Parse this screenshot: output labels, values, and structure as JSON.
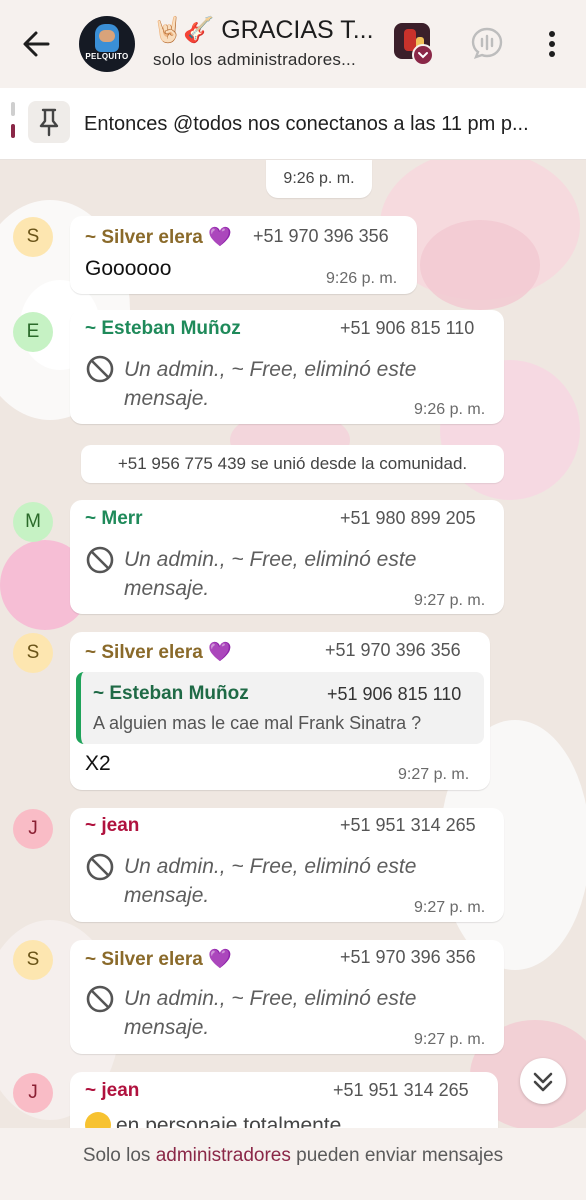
{
  "header": {
    "title": "🤘🏻🎸 GRACIAS T...",
    "subtitle": "solo los administradores...",
    "avatar_brand": "PELQUITO"
  },
  "pinned": {
    "text": "Entonces @todos  nos conectanos a las 11 pm p..."
  },
  "colors": {
    "header_bg": "#f6f1ee",
    "admin_accent": "#8a2747",
    "silver": "#8a6a2a",
    "esteban": "#1f8a5a",
    "merr": "#1f8a5a",
    "jean": "#b0123e"
  },
  "chat": {
    "top_time": "9:26 p. m.",
    "system_message": "+51 956 775 439 se unió desde la comunidad.",
    "messages": [
      {
        "initial": "S",
        "sender": "~ Silver elera 💜",
        "phone": "+51 970 396 356",
        "text": "Goooooo",
        "time": "9:26 p. m."
      },
      {
        "initial": "E",
        "sender": "~ Esteban Muñoz",
        "phone": "+51 906 815 110",
        "line1": "Un admin., ~ Free, eliminó este",
        "line2": "mensaje.",
        "time": "9:26 p. m."
      },
      {
        "initial": "M",
        "sender": "~ Merr",
        "phone": "+51 980 899 205",
        "line1": "Un admin., ~ Free, eliminó este",
        "line2": "mensaje.",
        "time": "9:27 p. m."
      },
      {
        "initial": "S",
        "sender": "~ Silver elera 💜",
        "phone": "+51 970 396 356",
        "quote_sender": "~ Esteban Muñoz",
        "quote_phone": "+51 906 815 110",
        "quote_text": "A alguien mas le cae mal Frank Sinatra ?",
        "text": "X2",
        "time": "9:27 p. m."
      },
      {
        "initial": "J",
        "sender": "~ jean",
        "phone": "+51 951 314 265",
        "line1": "Un admin., ~ Free, eliminó este",
        "line2": "mensaje.",
        "time": "9:27 p. m."
      },
      {
        "initial": "S",
        "sender": "~ Silver elera 💜",
        "phone": "+51 970 396 356",
        "line1": "Un admin., ~ Free, eliminó este",
        "line2": "mensaje.",
        "time": "9:27 p. m."
      },
      {
        "initial": "J",
        "sender": "~ jean",
        "phone": "+51 951 314 265",
        "partial_text": "en personaje totalmente"
      }
    ]
  },
  "footer": {
    "pre": "Solo los ",
    "admin_word": "administradores",
    "post": " pueden enviar mensajes"
  },
  "icons": [
    "back-arrow-icon",
    "group-avatar",
    "community-icon",
    "call-icon",
    "more-icon",
    "pin-icon",
    "ban-icon",
    "chevron-down-icon"
  ]
}
